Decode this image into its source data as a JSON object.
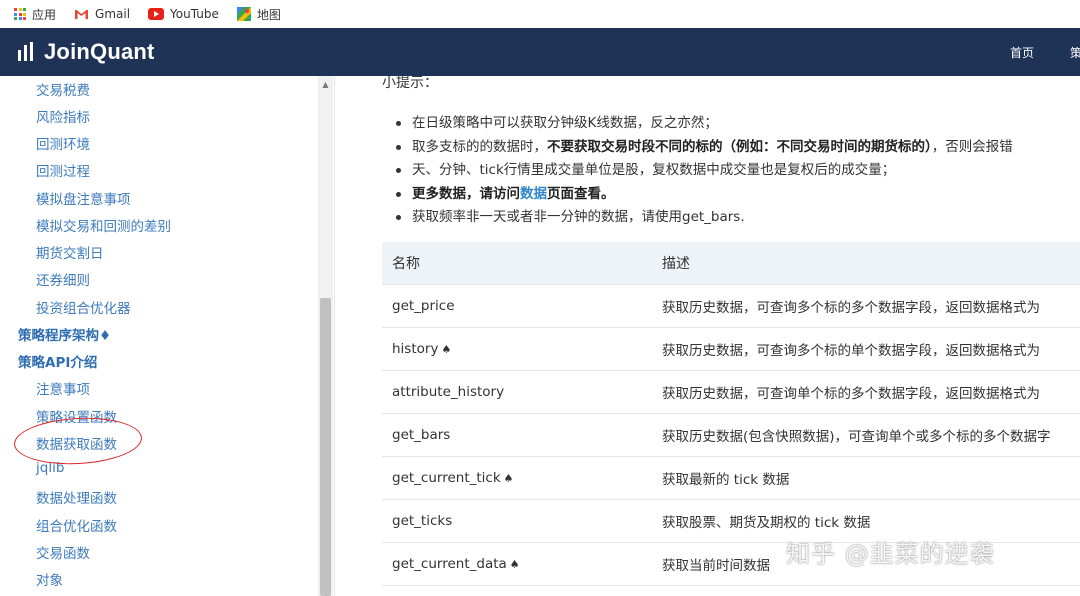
{
  "bookmarks": [
    {
      "label": "应用",
      "icon": "apps-grid-icon"
    },
    {
      "label": "Gmail",
      "icon": "gmail-icon"
    },
    {
      "label": "YouTube",
      "icon": "youtube-icon"
    },
    {
      "label": "地图",
      "icon": "maps-icon"
    }
  ],
  "header": {
    "logo_text": "JoinQuant",
    "nav": [
      "首页",
      "策"
    ],
    "background": "#1f3357"
  },
  "sidebar": {
    "items": [
      {
        "label": "交易税费",
        "level": 2
      },
      {
        "label": "风险指标",
        "level": 2
      },
      {
        "label": "回测环境",
        "level": 2
      },
      {
        "label": "回测过程",
        "level": 2
      },
      {
        "label": "模拟盘注意事项",
        "level": 2
      },
      {
        "label": "模拟交易和回测的差别",
        "level": 2
      },
      {
        "label": "期货交割日",
        "level": 2
      },
      {
        "label": "还券细则",
        "level": 2
      },
      {
        "label": "投资组合优化器",
        "level": 2
      },
      {
        "label": "策略程序架构♦",
        "level": 1
      },
      {
        "label": "策略API介绍",
        "level": 1
      },
      {
        "label": "注意事项",
        "level": 2
      },
      {
        "label": "策略设置函数",
        "level": 2
      },
      {
        "label": "数据获取函数",
        "level": 2,
        "highlighted": true
      },
      {
        "label": "jqlib",
        "level": 2
      },
      {
        "label": "数据处理函数",
        "level": 2
      },
      {
        "label": "组合优化函数",
        "level": 2
      },
      {
        "label": "交易函数",
        "level": 2
      },
      {
        "label": "对象",
        "level": 2
      }
    ],
    "link_color": "#3d7bbd",
    "highlight_color": "#d9262c"
  },
  "main": {
    "tip_title": "小提示：",
    "bullets": {
      "b1": "在日级策略中可以获取分钟级K线数据，反之亦然；",
      "b2_pre": "取多支标的的数据时，",
      "b2_bold": "不要获取交易时段不同的标的（例如：不同交易时间的期货标的）",
      "b2_post": "，否则会报错",
      "b3": "天、分钟、tick行情里成交量单位是股，复权数据中成交量也是复权后的成交量；",
      "b4_pre": "更多数据，请访问",
      "b4_link": "数据",
      "b4_post": "页面查看。",
      "b5": "获取频率非一天或者非一分钟的数据，请使用get_bars."
    },
    "table": {
      "headers": [
        "名称",
        "描述"
      ],
      "rows": [
        {
          "name": "get_price",
          "spade": "",
          "desc": "获取历史数据，可查询多个标的多个数据字段，返回数据格式为"
        },
        {
          "name": "history",
          "spade": "♠",
          "desc": "获取历史数据，可查询多个标的单个数据字段，返回数据格式为"
        },
        {
          "name": "attribute_history",
          "spade": "",
          "desc": "获取历史数据，可查询单个标的多个数据字段，返回数据格式为"
        },
        {
          "name": "get_bars",
          "spade": "",
          "desc": "获取历史数据(包含快照数据)，可查询单个或多个标的多个数据字"
        },
        {
          "name": "get_current_tick",
          "spade": "♠",
          "desc": "获取最新的 tick 数据"
        },
        {
          "name": "get_ticks",
          "spade": "",
          "desc": "获取股票、期货及期权的 tick 数据"
        },
        {
          "name": "get_current_data",
          "spade": "♠",
          "desc": "获取当前时间数据"
        }
      ]
    }
  },
  "watermark": "知乎 @韭菜的逆袭"
}
